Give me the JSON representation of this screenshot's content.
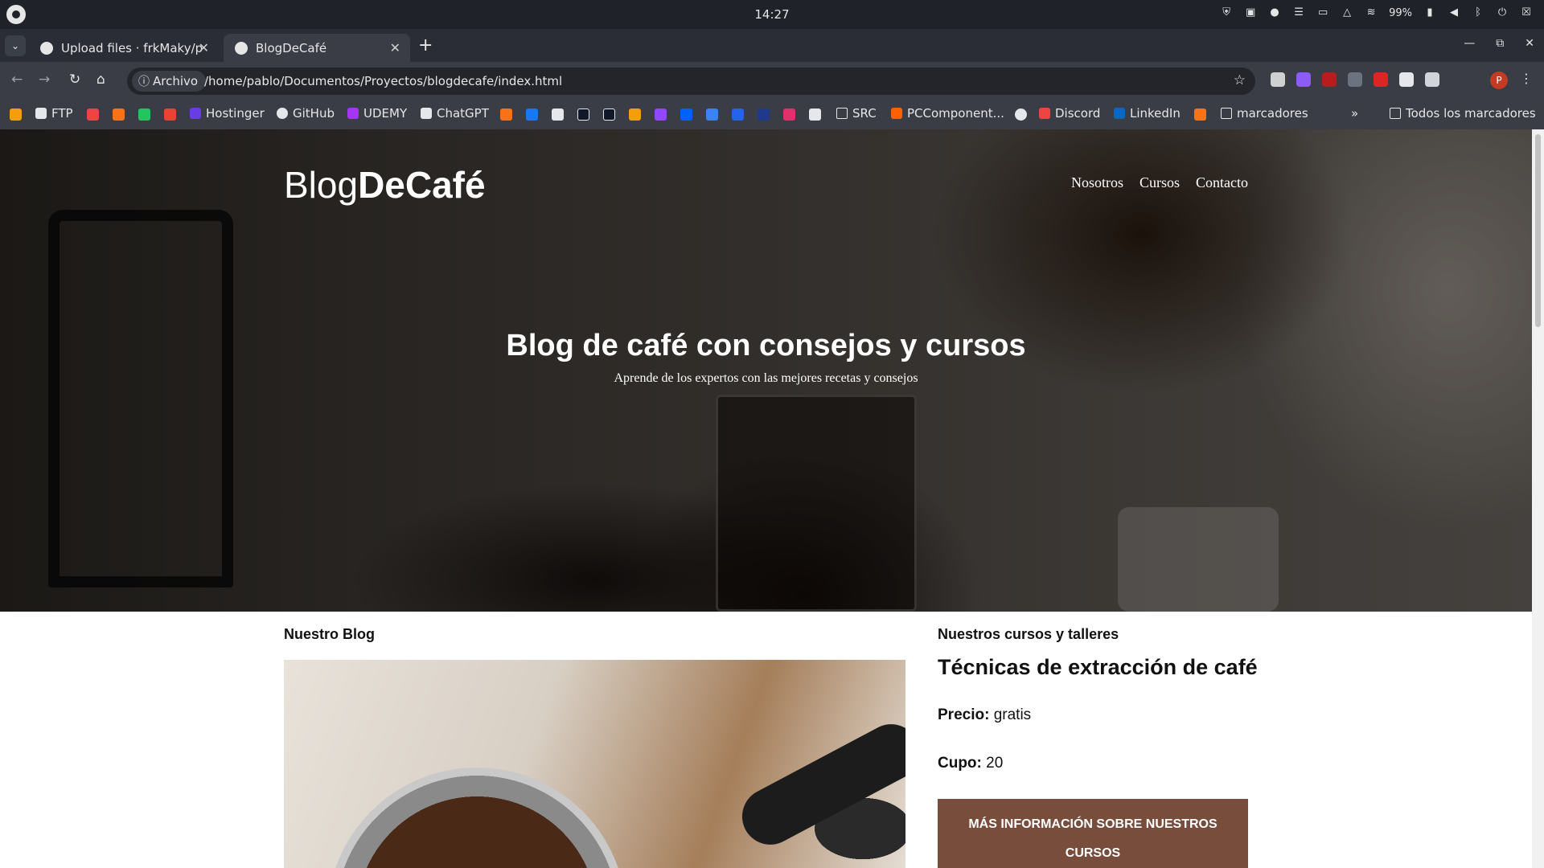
{
  "system": {
    "clock": "14:27",
    "battery": "99%"
  },
  "tabs": [
    {
      "title": "Upload files · frkMaky/p"
    },
    {
      "title": "BlogDeCafé"
    }
  ],
  "toolbar": {
    "chip_label": "Archivo",
    "url": "/home/pablo/Documentos/Proyectos/blogdecafe/index.html",
    "avatar_letter": "P"
  },
  "bookmarks": {
    "ftp": "FTP",
    "hostinger": "Hostinger",
    "github": "GitHub",
    "udemy": "UDEMY",
    "chatgpt": "ChatGPT",
    "src": "SRC",
    "pccomponentes": "PCComponent...",
    "discord": "Discord",
    "linkedin": "LinkedIn",
    "marcadores": "marcadores",
    "todos": "Todos los marcadores"
  },
  "site": {
    "logo_light": "Blog",
    "logo_bold": "DeCafé",
    "nav": [
      "Nosotros",
      "Cursos",
      "Contacto"
    ],
    "hero_title": "Blog de café con consejos y cursos",
    "hero_subtitle": "Aprende de los expertos con las mejores recetas y consejos"
  },
  "blog": {
    "heading": "Nuestro Blog"
  },
  "courses": {
    "heading": "Nuestros cursos y talleres",
    "title": "Técnicas de extracción de café",
    "price_label": "Precio:",
    "price_value": "gratis",
    "cupo_label": "Cupo:",
    "cupo_value": "20",
    "button": "Más información sobre nuestros cursos"
  },
  "colors": {
    "accent": "#784d3c"
  }
}
